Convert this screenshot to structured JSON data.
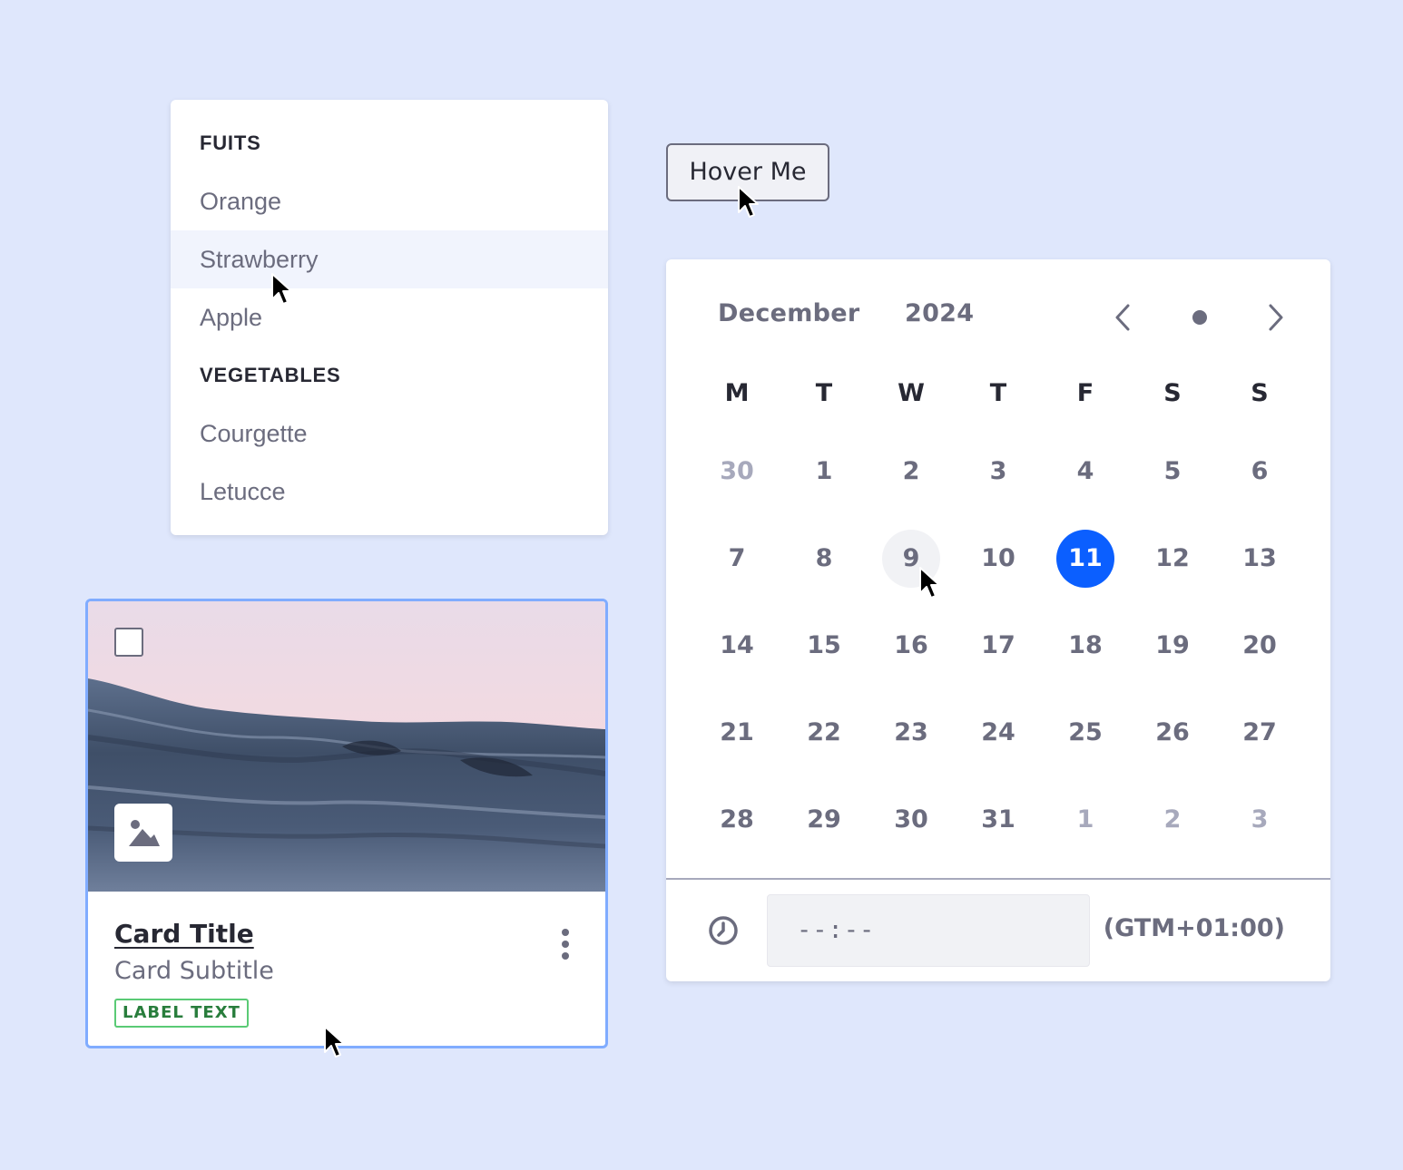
{
  "dropdown": {
    "groups": [
      {
        "header": "FUITS",
        "items": [
          "Orange",
          "Strawberry",
          "Apple"
        ]
      },
      {
        "header": "VEGETABLES",
        "items": [
          "Courgette",
          "Letucce"
        ]
      }
    ],
    "hovered_item": "Strawberry"
  },
  "hover_button": {
    "label": "Hover Me"
  },
  "calendar": {
    "month": "December",
    "year": "2024",
    "weekdays": [
      "M",
      "T",
      "W",
      "T",
      "F",
      "S",
      "S"
    ],
    "weeks": [
      [
        "30",
        "1",
        "2",
        "3",
        "4",
        "5",
        "6"
      ],
      [
        "7",
        "8",
        "9",
        "10",
        "11",
        "12",
        "13"
      ],
      [
        "14",
        "15",
        "16",
        "17",
        "18",
        "19",
        "20"
      ],
      [
        "21",
        "22",
        "23",
        "24",
        "25",
        "26",
        "27"
      ],
      [
        "28",
        "29",
        "30",
        "31",
        "1",
        "2",
        "3"
      ]
    ],
    "muted_days": {
      "first_week_leading": 1,
      "last_week_trailing": 3
    },
    "selected_day": "11",
    "hovered_day": "9",
    "time_value": "--:--",
    "timezone": "(GTM+01:00)",
    "icons": {
      "prev": "chevron-left-icon",
      "today": "dot-icon",
      "next": "chevron-right-icon",
      "clock": "clock-icon"
    }
  },
  "card": {
    "title": "Card Title",
    "subtitle": "Card Subtitle",
    "label": "LABEL TEXT",
    "image_description_icon": "image-icon",
    "menu_icon": "ellipsis-vertical-icon"
  },
  "colors": {
    "background": "#dfe7fc",
    "primary": "#0b5fff",
    "text_dark": "#272833",
    "text_secondary": "#6b6c7e",
    "text_muted": "#a7a9bc",
    "label_green": "#287d3c",
    "card_border": "#80acff"
  }
}
